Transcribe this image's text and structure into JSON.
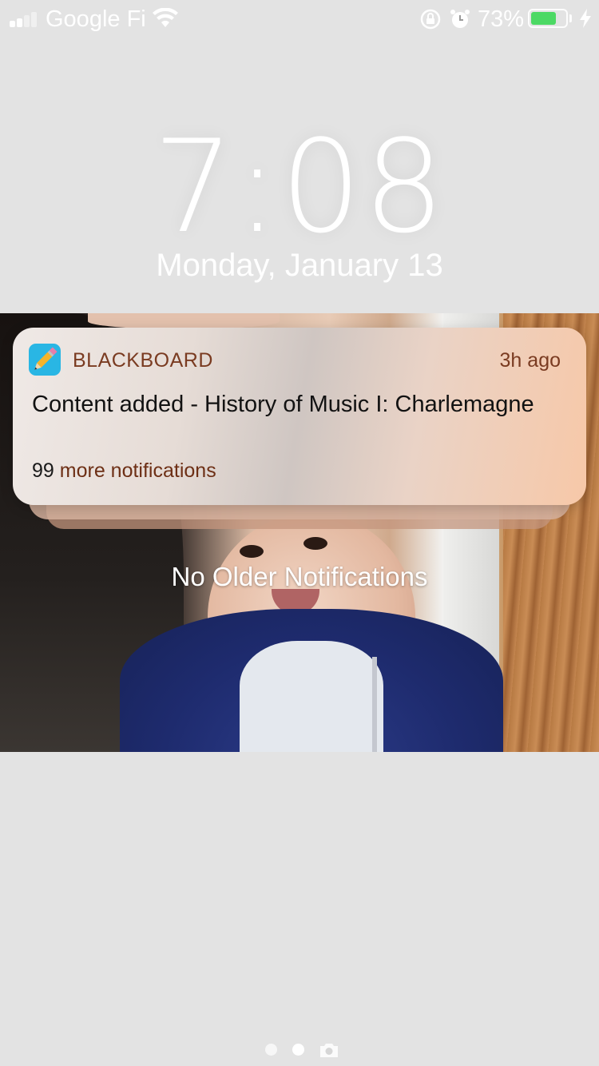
{
  "status_bar": {
    "carrier": "Google Fi",
    "battery_percent": "73%",
    "battery_level": 0.73,
    "battery_color": "#4cd964",
    "icons": [
      "signal-bars-icon",
      "wifi-icon",
      "rotation-lock-icon",
      "alarm-icon",
      "battery-icon",
      "charging-bolt-icon"
    ]
  },
  "lock_screen": {
    "time": "7:08",
    "date": "Monday, January 13"
  },
  "notification": {
    "app_icon": "pencil-icon",
    "app_name": "BLACKBOARD",
    "time_ago": "3h ago",
    "title": "Content added - History of Music I: Charlemagne",
    "more_count": "99",
    "more_label": "more notifications",
    "accent_color": "#7a3b21"
  },
  "no_older_label": "No Older Notifications",
  "page_indicator": {
    "pages": 2,
    "current_page": 2,
    "extra_icon": "camera-icon"
  }
}
